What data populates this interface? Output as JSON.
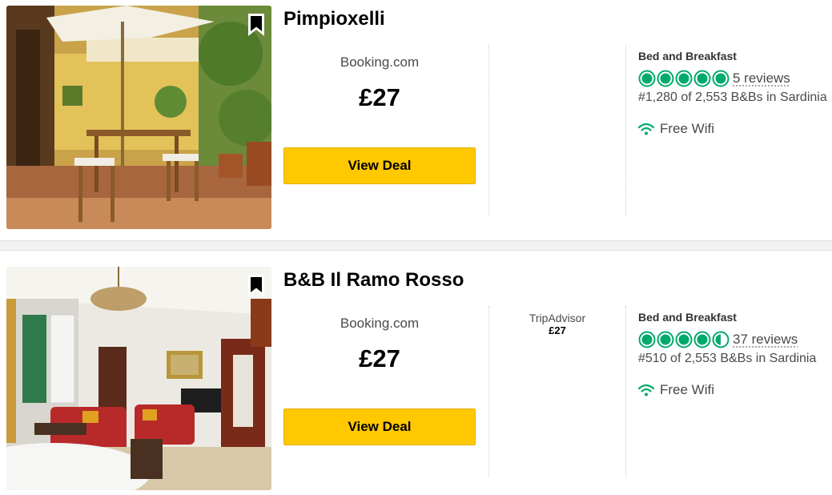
{
  "colors": {
    "accent_green": "#00aa6c",
    "deal_yellow": "#ffc800",
    "text_gray": "#4a4a4a"
  },
  "listings": [
    {
      "name": "Pimpioxelli",
      "main_offer": {
        "provider": "Booking.com",
        "price": "£27",
        "button_label": "View Deal"
      },
      "other_offers": [],
      "property_type": "Bed and Breakfast",
      "rating": 5,
      "reviews": "5 reviews",
      "rank": "#1,280 of 2,553 B&Bs in Sardinia",
      "amenity": "Free Wifi",
      "amenity_icon": "wifi-icon",
      "save_icon": "bookmark-icon"
    },
    {
      "name": "B&B Il Ramo Rosso",
      "main_offer": {
        "provider": "Booking.com",
        "price": "£27",
        "button_label": "View Deal"
      },
      "other_offers": [
        {
          "provider": "TripAdvisor",
          "price": "£27"
        }
      ],
      "property_type": "Bed and Breakfast",
      "rating": 4.5,
      "reviews": "37 reviews",
      "rank": "#510 of 2,553 B&Bs in Sardinia",
      "amenity": "Free Wifi",
      "amenity_icon": "wifi-icon",
      "save_icon": "bookmark-icon"
    }
  ]
}
